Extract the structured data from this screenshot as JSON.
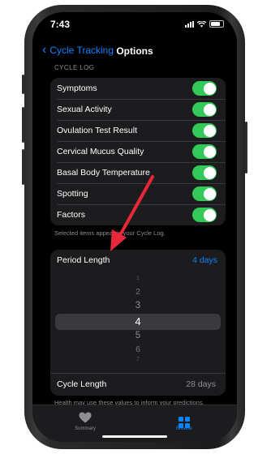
{
  "status_bar": {
    "time": "7:43"
  },
  "nav": {
    "back_label": "Cycle Tracking",
    "title": "Options"
  },
  "cycle_log": {
    "header": "CYCLE LOG",
    "items": [
      {
        "label": "Symptoms",
        "enabled": true
      },
      {
        "label": "Sexual Activity",
        "enabled": true
      },
      {
        "label": "Ovulation Test Result",
        "enabled": true
      },
      {
        "label": "Cervical Mucus Quality",
        "enabled": true
      },
      {
        "label": "Basal Body Temperature",
        "enabled": true
      },
      {
        "label": "Spotting",
        "enabled": true
      },
      {
        "label": "Factors",
        "enabled": true
      }
    ],
    "footnote": "Selected items appear in your Cycle Log."
  },
  "period": {
    "label": "Period Length",
    "value": "4 days",
    "picker": [
      "1",
      "2",
      "3",
      "4",
      "5",
      "6",
      "7"
    ],
    "selected": "4"
  },
  "cycle_length": {
    "label": "Cycle Length",
    "value": "28 days"
  },
  "predictions_note": "Health may use these values to inform your predictions.",
  "tabs": [
    {
      "label": "Summary",
      "icon": "heart-icon",
      "active": false
    },
    {
      "label": "Browse",
      "icon": "grid-icon",
      "active": true
    }
  ],
  "colors": {
    "accent": "#0a84ff",
    "toggle_on": "#34c759",
    "annotation_arrow": "#e8283a"
  }
}
